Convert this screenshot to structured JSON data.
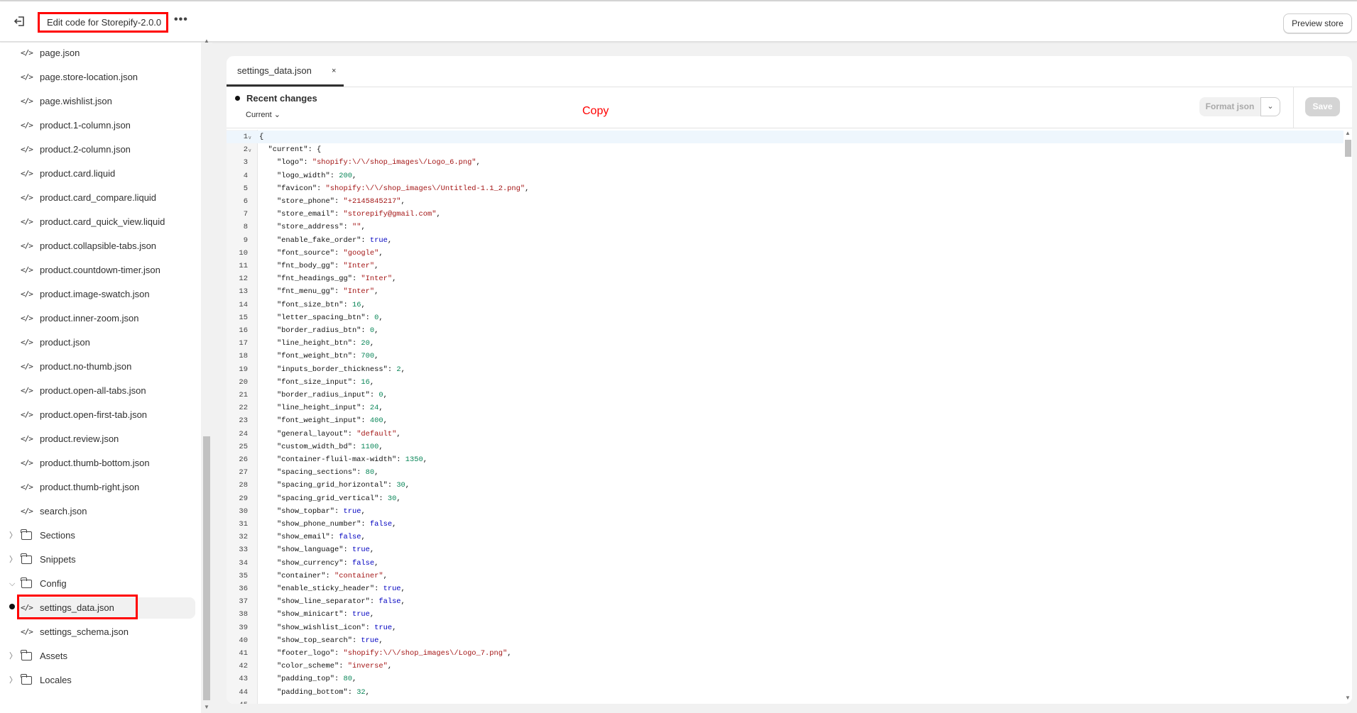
{
  "header": {
    "title": "Edit code for Storepify-2.0.0",
    "more": "•••",
    "preview": "Preview store"
  },
  "sidebar": {
    "items": [
      {
        "label": "page.json",
        "type": "file"
      },
      {
        "label": "page.store-location.json",
        "type": "file"
      },
      {
        "label": "page.wishlist.json",
        "type": "file"
      },
      {
        "label": "product.1-column.json",
        "type": "file"
      },
      {
        "label": "product.2-column.json",
        "type": "file"
      },
      {
        "label": "product.card.liquid",
        "type": "file"
      },
      {
        "label": "product.card_compare.liquid",
        "type": "file"
      },
      {
        "label": "product.card_quick_view.liquid",
        "type": "file"
      },
      {
        "label": "product.collapsible-tabs.json",
        "type": "file"
      },
      {
        "label": "product.countdown-timer.json",
        "type": "file"
      },
      {
        "label": "product.image-swatch.json",
        "type": "file"
      },
      {
        "label": "product.inner-zoom.json",
        "type": "file"
      },
      {
        "label": "product.json",
        "type": "file"
      },
      {
        "label": "product.no-thumb.json",
        "type": "file"
      },
      {
        "label": "product.open-all-tabs.json",
        "type": "file"
      },
      {
        "label": "product.open-first-tab.json",
        "type": "file"
      },
      {
        "label": "product.review.json",
        "type": "file"
      },
      {
        "label": "product.thumb-bottom.json",
        "type": "file"
      },
      {
        "label": "product.thumb-right.json",
        "type": "file"
      },
      {
        "label": "search.json",
        "type": "file"
      },
      {
        "label": "Sections",
        "type": "folder",
        "open": false
      },
      {
        "label": "Snippets",
        "type": "folder",
        "open": false
      },
      {
        "label": "Config",
        "type": "folder",
        "open": true
      },
      {
        "label": "settings_data.json",
        "type": "file",
        "active": true
      },
      {
        "label": "settings_schema.json",
        "type": "file"
      },
      {
        "label": "Assets",
        "type": "folder",
        "open": false
      },
      {
        "label": "Locales",
        "type": "folder",
        "open": false
      }
    ]
  },
  "editor": {
    "tab": "settings_data.json",
    "tab_close": "×",
    "recent": "Recent changes",
    "current": "Current",
    "annotation": "Copy",
    "format": "Format json",
    "save": "Save",
    "lines": [
      [
        [
          "p",
          "{"
        ]
      ],
      [
        [
          "p",
          "  \"current\": {"
        ]
      ],
      [
        [
          "p",
          "    \"logo\": "
        ],
        [
          "s",
          "\"shopify:\\/\\/shop_images\\/Logo_6.png\""
        ],
        [
          "p",
          ","
        ]
      ],
      [
        [
          "p",
          "    \"logo_width\": "
        ],
        [
          "n",
          "200"
        ],
        [
          "p",
          ","
        ]
      ],
      [
        [
          "p",
          "    \"favicon\": "
        ],
        [
          "s",
          "\"shopify:\\/\\/shop_images\\/Untitled-1.1_2.png\""
        ],
        [
          "p",
          ","
        ]
      ],
      [
        [
          "p",
          "    \"store_phone\": "
        ],
        [
          "s",
          "\"+2145845217\""
        ],
        [
          "p",
          ","
        ]
      ],
      [
        [
          "p",
          "    \"store_email\": "
        ],
        [
          "s",
          "\"storepify@gmail.com\""
        ],
        [
          "p",
          ","
        ]
      ],
      [
        [
          "p",
          "    \"store_address\": "
        ],
        [
          "s",
          "\"\""
        ],
        [
          "p",
          ","
        ]
      ],
      [
        [
          "p",
          "    \"enable_fake_order\": "
        ],
        [
          "b",
          "true"
        ],
        [
          "p",
          ","
        ]
      ],
      [
        [
          "p",
          "    \"font_source\": "
        ],
        [
          "s",
          "\"google\""
        ],
        [
          "p",
          ","
        ]
      ],
      [
        [
          "p",
          "    \"fnt_body_gg\": "
        ],
        [
          "s",
          "\"Inter\""
        ],
        [
          "p",
          ","
        ]
      ],
      [
        [
          "p",
          "    \"fnt_headings_gg\": "
        ],
        [
          "s",
          "\"Inter\""
        ],
        [
          "p",
          ","
        ]
      ],
      [
        [
          "p",
          "    \"fnt_menu_gg\": "
        ],
        [
          "s",
          "\"Inter\""
        ],
        [
          "p",
          ","
        ]
      ],
      [
        [
          "p",
          "    \"font_size_btn\": "
        ],
        [
          "n",
          "16"
        ],
        [
          "p",
          ","
        ]
      ],
      [
        [
          "p",
          "    \"letter_spacing_btn\": "
        ],
        [
          "n",
          "0"
        ],
        [
          "p",
          ","
        ]
      ],
      [
        [
          "p",
          "    \"border_radius_btn\": "
        ],
        [
          "n",
          "0"
        ],
        [
          "p",
          ","
        ]
      ],
      [
        [
          "p",
          "    \"line_height_btn\": "
        ],
        [
          "n",
          "20"
        ],
        [
          "p",
          ","
        ]
      ],
      [
        [
          "p",
          "    \"font_weight_btn\": "
        ],
        [
          "n",
          "700"
        ],
        [
          "p",
          ","
        ]
      ],
      [
        [
          "p",
          "    \"inputs_border_thickness\": "
        ],
        [
          "n",
          "2"
        ],
        [
          "p",
          ","
        ]
      ],
      [
        [
          "p",
          "    \"font_size_input\": "
        ],
        [
          "n",
          "16"
        ],
        [
          "p",
          ","
        ]
      ],
      [
        [
          "p",
          "    \"border_radius_input\": "
        ],
        [
          "n",
          "0"
        ],
        [
          "p",
          ","
        ]
      ],
      [
        [
          "p",
          "    \"line_height_input\": "
        ],
        [
          "n",
          "24"
        ],
        [
          "p",
          ","
        ]
      ],
      [
        [
          "p",
          "    \"font_weight_input\": "
        ],
        [
          "n",
          "400"
        ],
        [
          "p",
          ","
        ]
      ],
      [
        [
          "p",
          "    \"general_layout\": "
        ],
        [
          "s",
          "\"default\""
        ],
        [
          "p",
          ","
        ]
      ],
      [
        [
          "p",
          "    \"custom_width_bd\": "
        ],
        [
          "n",
          "1100"
        ],
        [
          "p",
          ","
        ]
      ],
      [
        [
          "p",
          "    \"container-fluil-max-width\": "
        ],
        [
          "n",
          "1350"
        ],
        [
          "p",
          ","
        ]
      ],
      [
        [
          "p",
          "    \"spacing_sections\": "
        ],
        [
          "n",
          "80"
        ],
        [
          "p",
          ","
        ]
      ],
      [
        [
          "p",
          "    \"spacing_grid_horizontal\": "
        ],
        [
          "n",
          "30"
        ],
        [
          "p",
          ","
        ]
      ],
      [
        [
          "p",
          "    \"spacing_grid_vertical\": "
        ],
        [
          "n",
          "30"
        ],
        [
          "p",
          ","
        ]
      ],
      [
        [
          "p",
          "    \"show_topbar\": "
        ],
        [
          "b",
          "true"
        ],
        [
          "p",
          ","
        ]
      ],
      [
        [
          "p",
          "    \"show_phone_number\": "
        ],
        [
          "b",
          "false"
        ],
        [
          "p",
          ","
        ]
      ],
      [
        [
          "p",
          "    \"show_email\": "
        ],
        [
          "b",
          "false"
        ],
        [
          "p",
          ","
        ]
      ],
      [
        [
          "p",
          "    \"show_language\": "
        ],
        [
          "b",
          "true"
        ],
        [
          "p",
          ","
        ]
      ],
      [
        [
          "p",
          "    \"show_currency\": "
        ],
        [
          "b",
          "false"
        ],
        [
          "p",
          ","
        ]
      ],
      [
        [
          "p",
          "    \"container\": "
        ],
        [
          "s",
          "\"container\""
        ],
        [
          "p",
          ","
        ]
      ],
      [
        [
          "p",
          "    \"enable_sticky_header\": "
        ],
        [
          "b",
          "true"
        ],
        [
          "p",
          ","
        ]
      ],
      [
        [
          "p",
          "    \"show_line_separator\": "
        ],
        [
          "b",
          "false"
        ],
        [
          "p",
          ","
        ]
      ],
      [
        [
          "p",
          "    \"show_minicart\": "
        ],
        [
          "b",
          "true"
        ],
        [
          "p",
          ","
        ]
      ],
      [
        [
          "p",
          "    \"show_wishlist_icon\": "
        ],
        [
          "b",
          "true"
        ],
        [
          "p",
          ","
        ]
      ],
      [
        [
          "p",
          "    \"show_top_search\": "
        ],
        [
          "b",
          "true"
        ],
        [
          "p",
          ","
        ]
      ],
      [
        [
          "p",
          "    \"footer_logo\": "
        ],
        [
          "s",
          "\"shopify:\\/\\/shop_images\\/Logo_7.png\""
        ],
        [
          "p",
          ","
        ]
      ],
      [
        [
          "p",
          "    \"color_scheme\": "
        ],
        [
          "s",
          "\"inverse\""
        ],
        [
          "p",
          ","
        ]
      ],
      [
        [
          "p",
          "    \"padding_top\": "
        ],
        [
          "n",
          "80"
        ],
        [
          "p",
          ","
        ]
      ],
      [
        [
          "p",
          "    \"padding_bottom\": "
        ],
        [
          "n",
          "32"
        ],
        [
          "p",
          ","
        ]
      ]
    ]
  },
  "colors": {
    "annotation": "#ff0000",
    "string": "#a31515",
    "number": "#098658",
    "boolean": "#0000c0"
  }
}
